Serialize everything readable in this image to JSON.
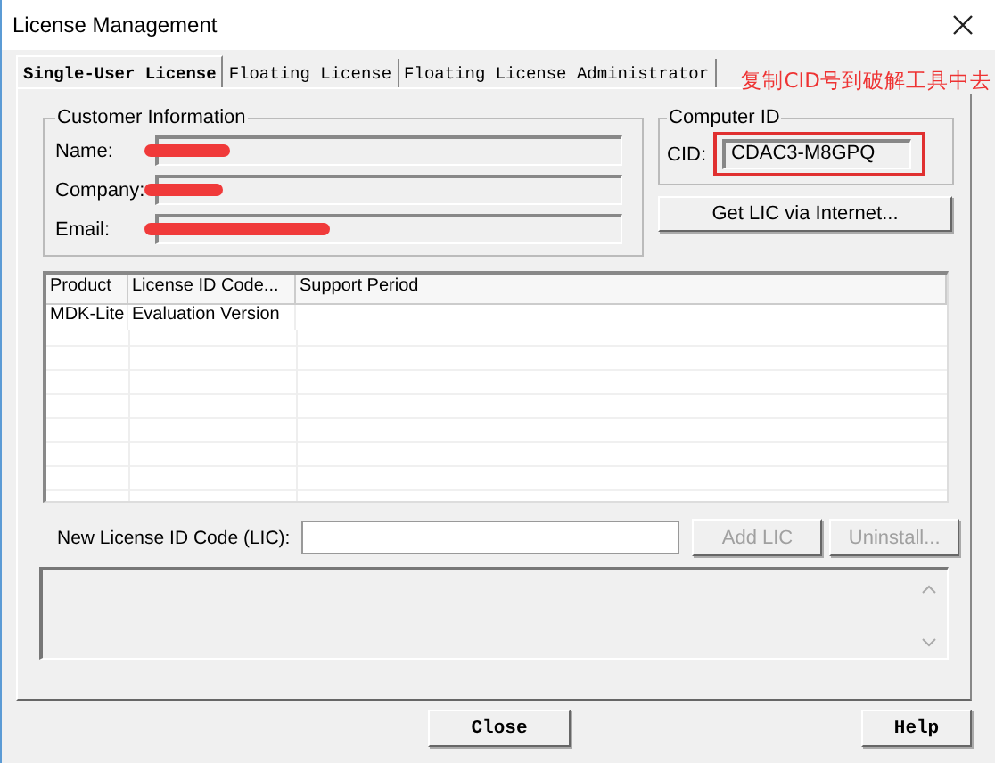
{
  "window": {
    "title": "License Management"
  },
  "tabs": [
    {
      "label": "Single-User License",
      "selected": true
    },
    {
      "label": "Floating License",
      "selected": false
    },
    {
      "label": "Floating License Administrator",
      "selected": false
    }
  ],
  "annotation": {
    "text": "复制CID号到破解工具中去"
  },
  "customer_information": {
    "title": "Customer Information",
    "fields": [
      {
        "label": "Name:",
        "redacted": true
      },
      {
        "label": "Company:",
        "redacted": true
      },
      {
        "label": "Email:",
        "redacted": true
      }
    ]
  },
  "computer_id": {
    "title": "Computer ID",
    "label": "CID:",
    "value": "CDAC3-M8GPQ"
  },
  "get_lic_button": {
    "label": "Get LIC via Internet...",
    "disabled": false
  },
  "table": {
    "columns": [
      "Product",
      "License ID Code...",
      "Support Period"
    ],
    "rows": [
      [
        "MDK-Lite",
        "Evaluation Version"
      ]
    ]
  },
  "new_lic": {
    "label": "New License ID Code (LIC):",
    "buttons": [
      {
        "label": "Add LIC",
        "disabled": true
      },
      {
        "label": "Uninstall...",
        "disabled": true
      }
    ]
  },
  "footer_buttons": [
    {
      "label": "Close",
      "disabled": false
    },
    {
      "label": "Help",
      "disabled": false
    }
  ]
}
